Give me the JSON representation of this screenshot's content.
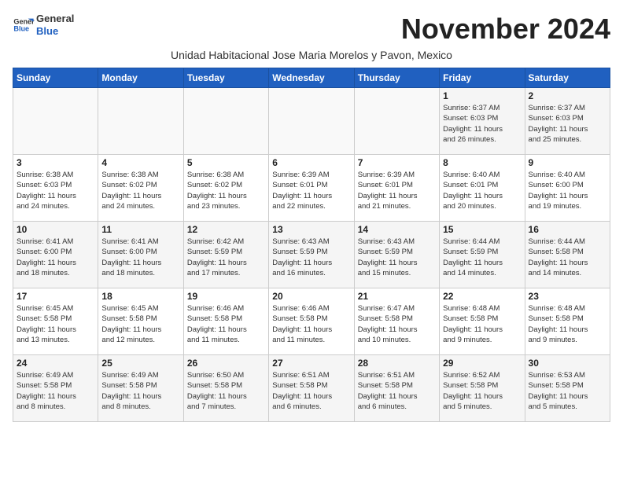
{
  "header": {
    "logo_line1": "General",
    "logo_line2": "Blue",
    "month_title": "November 2024",
    "subtitle": "Unidad Habitacional Jose Maria Morelos y Pavon, Mexico"
  },
  "weekdays": [
    "Sunday",
    "Monday",
    "Tuesday",
    "Wednesday",
    "Thursday",
    "Friday",
    "Saturday"
  ],
  "weeks": [
    [
      {
        "day": "",
        "info": ""
      },
      {
        "day": "",
        "info": ""
      },
      {
        "day": "",
        "info": ""
      },
      {
        "day": "",
        "info": ""
      },
      {
        "day": "",
        "info": ""
      },
      {
        "day": "1",
        "info": "Sunrise: 6:37 AM\nSunset: 6:03 PM\nDaylight: 11 hours\nand 26 minutes."
      },
      {
        "day": "2",
        "info": "Sunrise: 6:37 AM\nSunset: 6:03 PM\nDaylight: 11 hours\nand 25 minutes."
      }
    ],
    [
      {
        "day": "3",
        "info": "Sunrise: 6:38 AM\nSunset: 6:03 PM\nDaylight: 11 hours\nand 24 minutes."
      },
      {
        "day": "4",
        "info": "Sunrise: 6:38 AM\nSunset: 6:02 PM\nDaylight: 11 hours\nand 24 minutes."
      },
      {
        "day": "5",
        "info": "Sunrise: 6:38 AM\nSunset: 6:02 PM\nDaylight: 11 hours\nand 23 minutes."
      },
      {
        "day": "6",
        "info": "Sunrise: 6:39 AM\nSunset: 6:01 PM\nDaylight: 11 hours\nand 22 minutes."
      },
      {
        "day": "7",
        "info": "Sunrise: 6:39 AM\nSunset: 6:01 PM\nDaylight: 11 hours\nand 21 minutes."
      },
      {
        "day": "8",
        "info": "Sunrise: 6:40 AM\nSunset: 6:01 PM\nDaylight: 11 hours\nand 20 minutes."
      },
      {
        "day": "9",
        "info": "Sunrise: 6:40 AM\nSunset: 6:00 PM\nDaylight: 11 hours\nand 19 minutes."
      }
    ],
    [
      {
        "day": "10",
        "info": "Sunrise: 6:41 AM\nSunset: 6:00 PM\nDaylight: 11 hours\nand 18 minutes."
      },
      {
        "day": "11",
        "info": "Sunrise: 6:41 AM\nSunset: 6:00 PM\nDaylight: 11 hours\nand 18 minutes."
      },
      {
        "day": "12",
        "info": "Sunrise: 6:42 AM\nSunset: 5:59 PM\nDaylight: 11 hours\nand 17 minutes."
      },
      {
        "day": "13",
        "info": "Sunrise: 6:43 AM\nSunset: 5:59 PM\nDaylight: 11 hours\nand 16 minutes."
      },
      {
        "day": "14",
        "info": "Sunrise: 6:43 AM\nSunset: 5:59 PM\nDaylight: 11 hours\nand 15 minutes."
      },
      {
        "day": "15",
        "info": "Sunrise: 6:44 AM\nSunset: 5:59 PM\nDaylight: 11 hours\nand 14 minutes."
      },
      {
        "day": "16",
        "info": "Sunrise: 6:44 AM\nSunset: 5:58 PM\nDaylight: 11 hours\nand 14 minutes."
      }
    ],
    [
      {
        "day": "17",
        "info": "Sunrise: 6:45 AM\nSunset: 5:58 PM\nDaylight: 11 hours\nand 13 minutes."
      },
      {
        "day": "18",
        "info": "Sunrise: 6:45 AM\nSunset: 5:58 PM\nDaylight: 11 hours\nand 12 minutes."
      },
      {
        "day": "19",
        "info": "Sunrise: 6:46 AM\nSunset: 5:58 PM\nDaylight: 11 hours\nand 11 minutes."
      },
      {
        "day": "20",
        "info": "Sunrise: 6:46 AM\nSunset: 5:58 PM\nDaylight: 11 hours\nand 11 minutes."
      },
      {
        "day": "21",
        "info": "Sunrise: 6:47 AM\nSunset: 5:58 PM\nDaylight: 11 hours\nand 10 minutes."
      },
      {
        "day": "22",
        "info": "Sunrise: 6:48 AM\nSunset: 5:58 PM\nDaylight: 11 hours\nand 9 minutes."
      },
      {
        "day": "23",
        "info": "Sunrise: 6:48 AM\nSunset: 5:58 PM\nDaylight: 11 hours\nand 9 minutes."
      }
    ],
    [
      {
        "day": "24",
        "info": "Sunrise: 6:49 AM\nSunset: 5:58 PM\nDaylight: 11 hours\nand 8 minutes."
      },
      {
        "day": "25",
        "info": "Sunrise: 6:49 AM\nSunset: 5:58 PM\nDaylight: 11 hours\nand 8 minutes."
      },
      {
        "day": "26",
        "info": "Sunrise: 6:50 AM\nSunset: 5:58 PM\nDaylight: 11 hours\nand 7 minutes."
      },
      {
        "day": "27",
        "info": "Sunrise: 6:51 AM\nSunset: 5:58 PM\nDaylight: 11 hours\nand 6 minutes."
      },
      {
        "day": "28",
        "info": "Sunrise: 6:51 AM\nSunset: 5:58 PM\nDaylight: 11 hours\nand 6 minutes."
      },
      {
        "day": "29",
        "info": "Sunrise: 6:52 AM\nSunset: 5:58 PM\nDaylight: 11 hours\nand 5 minutes."
      },
      {
        "day": "30",
        "info": "Sunrise: 6:53 AM\nSunset: 5:58 PM\nDaylight: 11 hours\nand 5 minutes."
      }
    ]
  ]
}
